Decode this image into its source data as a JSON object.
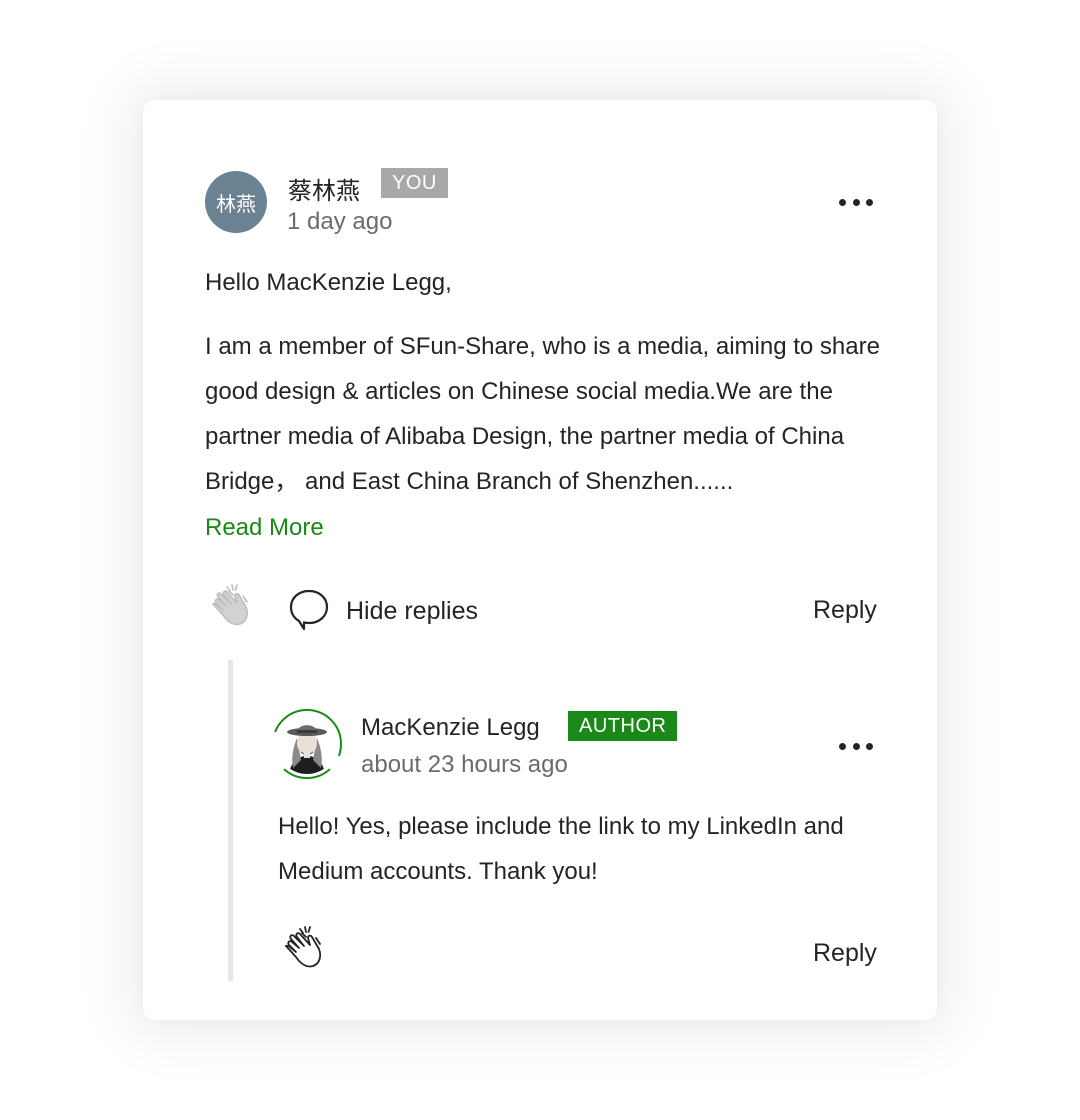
{
  "comment": {
    "avatar_text": "林燕",
    "author_name": "蔡林燕",
    "badge": "YOU",
    "timestamp": "1 day ago",
    "greeting": "Hello MacKenzie Legg,",
    "body": "I am a member of SFun-Share, who is a media, aiming to share good design & articles on Chinese social media.We are the partner media of Alibaba Design, the partner media of China Bridge， and East China Branch of Shenzhen......",
    "read_more": "Read More",
    "hide_replies": "Hide replies",
    "reply": "Reply"
  },
  "reply_comment": {
    "author_name": "MacKenzie Legg",
    "badge": "AUTHOR",
    "timestamp": "about 23 hours ago",
    "body": "Hello! Yes, please include the link to my LinkedIn and Medium accounts. Thank you!",
    "reply": "Reply"
  },
  "colors": {
    "accent_green": "#1a8917",
    "avatar_bg": "#6b8292",
    "you_badge": "#a8a8a8"
  },
  "icons": [
    "clap-icon",
    "comment-bubble-icon",
    "more-options-icon"
  ]
}
